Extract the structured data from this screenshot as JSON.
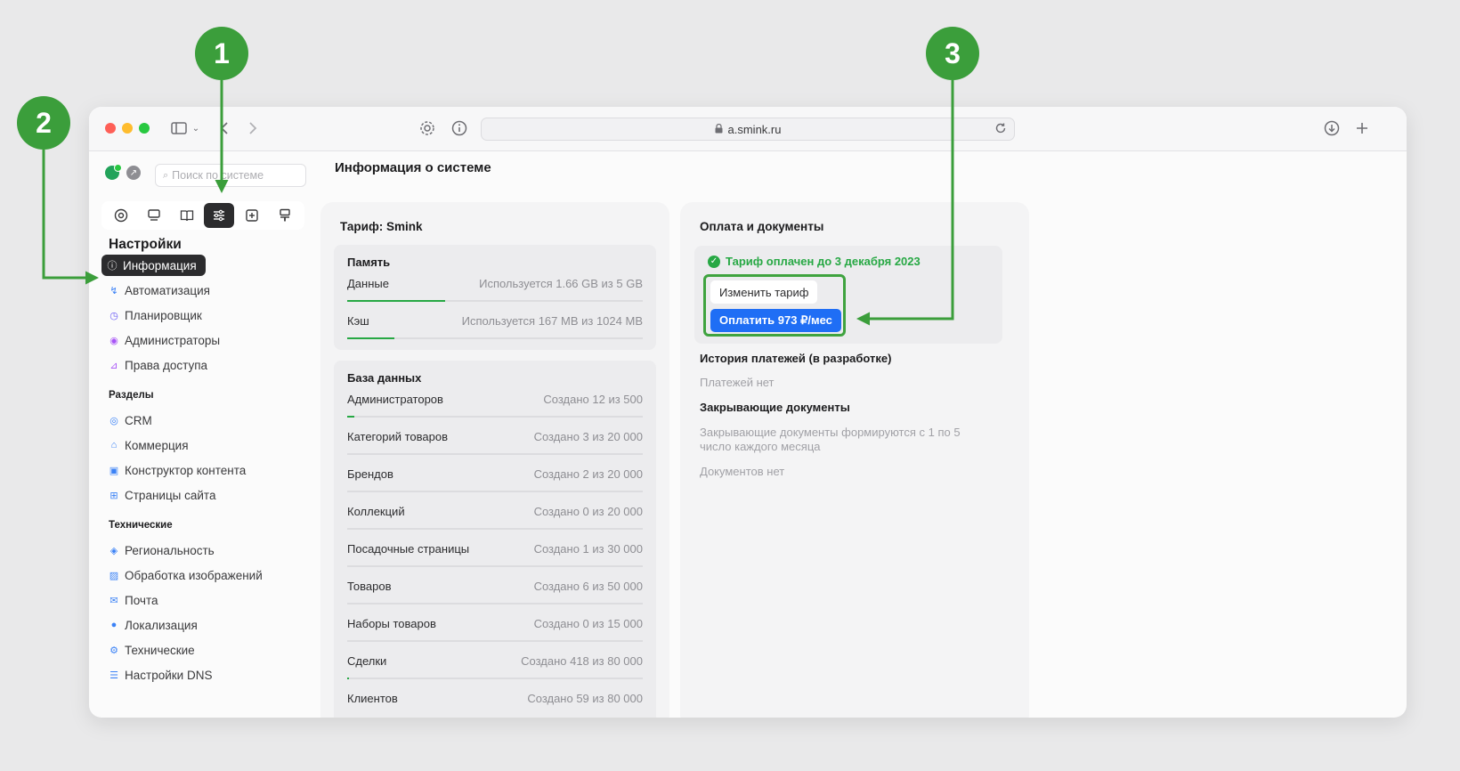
{
  "browser": {
    "url": "a.smink.ru"
  },
  "sidebar": {
    "search_placeholder": "Поиск по системе",
    "heading": "Настройки",
    "settings_items": [
      {
        "label": "Информация",
        "icon": "info-icon"
      },
      {
        "label": "Автоматизация",
        "icon": "automation-icon"
      },
      {
        "label": "Планировщик",
        "icon": "scheduler-icon"
      },
      {
        "label": "Администраторы",
        "icon": "admins-icon"
      },
      {
        "label": "Права доступа",
        "icon": "access-icon"
      }
    ],
    "sections_label": "Разделы",
    "section_items": [
      {
        "label": "CRM",
        "icon": "crm-icon"
      },
      {
        "label": "Коммерция",
        "icon": "commerce-icon"
      },
      {
        "label": "Конструктор контента",
        "icon": "content-builder-icon"
      },
      {
        "label": "Страницы сайта",
        "icon": "site-pages-icon"
      }
    ],
    "technical_label": "Технические",
    "technical_items": [
      {
        "label": "Региональность",
        "icon": "region-icon"
      },
      {
        "label": "Обработка изображений",
        "icon": "image-processing-icon"
      },
      {
        "label": "Почта",
        "icon": "mail-icon"
      },
      {
        "label": "Локализация",
        "icon": "localization-icon"
      },
      {
        "label": "Технические",
        "icon": "technical-icon"
      },
      {
        "label": "Настройки DNS",
        "icon": "dns-icon"
      }
    ]
  },
  "main": {
    "title": "Информация о системе",
    "tariff_title": "Тариф: Smink",
    "memory": {
      "heading": "Память",
      "rows": [
        {
          "label": "Данные",
          "value": "Используется 1.66 GB из 5 GB",
          "fill": 0.33
        },
        {
          "label": "Кэш",
          "value": "Используется 167 MB из 1024 MB",
          "fill": 0.16
        }
      ]
    },
    "database": {
      "heading": "База данных",
      "rows": [
        {
          "label": "Администраторов",
          "value": "Создано 12 из 500",
          "fill": 0.024
        },
        {
          "label": "Категорий товаров",
          "value": "Создано 3 из 20 000",
          "fill": 0.0
        },
        {
          "label": "Брендов",
          "value": "Создано 2 из 20 000",
          "fill": 0.0
        },
        {
          "label": "Коллекций",
          "value": "Создано 0 из 20 000",
          "fill": 0.0
        },
        {
          "label": "Посадочные страницы",
          "value": "Создано 1 из 30 000",
          "fill": 0.0
        },
        {
          "label": "Товаров",
          "value": "Создано 6 из 50 000",
          "fill": 0.0
        },
        {
          "label": "Наборы товаров",
          "value": "Создано 0 из 15 000",
          "fill": 0.0
        },
        {
          "label": "Сделки",
          "value": "Создано 418 из 80 000",
          "fill": 0.005
        },
        {
          "label": "Клиентов",
          "value": "Создано 59 из 80 000",
          "fill": 0.0
        }
      ]
    },
    "payment": {
      "title": "Оплата и документы",
      "paid_status": "Тариф оплачен до 3 декабря 2023",
      "change_button": "Изменить тариф",
      "pay_button": "Оплатить 973 ₽/мес",
      "history_title": "История платежей (в разработке)",
      "history_empty": "Платежей нет",
      "docs_title": "Закрывающие документы",
      "docs_note_line1": "Закрывающие документы формируются с 1 по 5",
      "docs_note_line2": "число каждого месяца",
      "docs_empty": "Документов нет"
    }
  },
  "callouts": [
    "1",
    "2",
    "3"
  ],
  "colors": {
    "accent_green": "#3b9e3b",
    "pay_blue": "#1f6ef5",
    "active_dark": "#2c2c2e"
  }
}
